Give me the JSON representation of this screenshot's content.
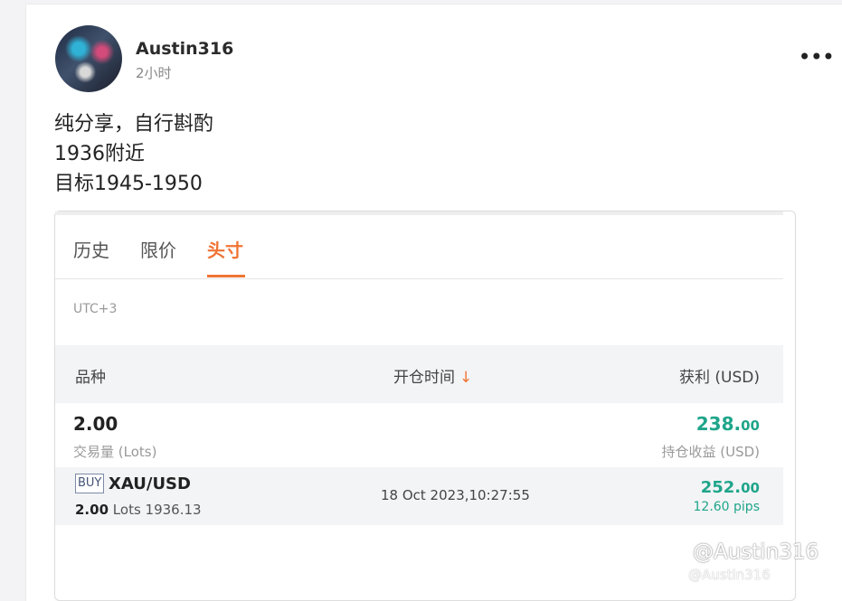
{
  "post": {
    "username": "Austin316",
    "time": "2小时",
    "more": "•••",
    "lines": [
      "纯分享，自行斟酌",
      "1936附近",
      "目标1945-1950"
    ]
  },
  "embed": {
    "tabs": [
      "历史",
      "限价",
      "头寸"
    ],
    "active_tab": "头寸",
    "timezone": "UTC+3",
    "columns": {
      "symbol": "品种",
      "open_time": "开仓时间",
      "sort_arrow": "↓",
      "profit": "获利 (USD)"
    },
    "summary": {
      "lots": "2.00",
      "lots_label": "交易量 (Lots)",
      "profit_int": "238.",
      "profit_dec": "00",
      "profit_label": "持仓收益 (USD)"
    },
    "position": {
      "side": "BUY",
      "symbol": "XAU/USD",
      "lots": "2.00",
      "lots_unit": "Lots",
      "price": "1936.13",
      "open_time": "18 Oct 2023,10:27:55",
      "profit_int": "252.",
      "profit_dec": "00",
      "pips": "12.60 pips"
    }
  },
  "watermark": {
    "large": "@Austin316",
    "small": "@Austin316"
  },
  "colors": {
    "accent": "#f07433",
    "profit": "#1fa58a"
  }
}
